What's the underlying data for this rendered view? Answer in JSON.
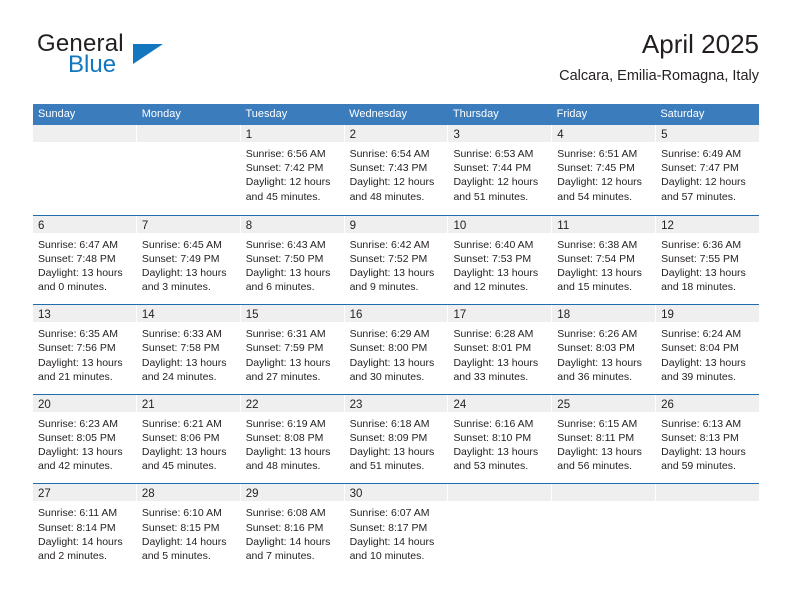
{
  "brand": {
    "name_top": "General",
    "name_bottom": "Blue"
  },
  "header": {
    "title": "April 2025",
    "subtitle": "Calcara, Emilia-Romagna, Italy"
  },
  "theme": {
    "header_blue": "#3b7cbd",
    "separator_blue": "#1f6cb0",
    "daynum_band": "#efefef",
    "brand_blue": "#1277bf",
    "text": "#231f20"
  },
  "labels": {
    "sunrise_prefix": "Sunrise:",
    "sunset_prefix": "Sunset:",
    "daylight_prefix": "Daylight:"
  },
  "weekdays": [
    "Sunday",
    "Monday",
    "Tuesday",
    "Wednesday",
    "Thursday",
    "Friday",
    "Saturday"
  ],
  "weeks": [
    [
      {
        "day": ""
      },
      {
        "day": ""
      },
      {
        "day": "1",
        "sunrise": "Sunrise: 6:56 AM",
        "sunset": "Sunset: 7:42 PM",
        "daylight_1": "Daylight: 12 hours",
        "daylight_2": "and 45 minutes."
      },
      {
        "day": "2",
        "sunrise": "Sunrise: 6:54 AM",
        "sunset": "Sunset: 7:43 PM",
        "daylight_1": "Daylight: 12 hours",
        "daylight_2": "and 48 minutes."
      },
      {
        "day": "3",
        "sunrise": "Sunrise: 6:53 AM",
        "sunset": "Sunset: 7:44 PM",
        "daylight_1": "Daylight: 12 hours",
        "daylight_2": "and 51 minutes."
      },
      {
        "day": "4",
        "sunrise": "Sunrise: 6:51 AM",
        "sunset": "Sunset: 7:45 PM",
        "daylight_1": "Daylight: 12 hours",
        "daylight_2": "and 54 minutes."
      },
      {
        "day": "5",
        "sunrise": "Sunrise: 6:49 AM",
        "sunset": "Sunset: 7:47 PM",
        "daylight_1": "Daylight: 12 hours",
        "daylight_2": "and 57 minutes."
      }
    ],
    [
      {
        "day": "6",
        "sunrise": "Sunrise: 6:47 AM",
        "sunset": "Sunset: 7:48 PM",
        "daylight_1": "Daylight: 13 hours",
        "daylight_2": "and 0 minutes."
      },
      {
        "day": "7",
        "sunrise": "Sunrise: 6:45 AM",
        "sunset": "Sunset: 7:49 PM",
        "daylight_1": "Daylight: 13 hours",
        "daylight_2": "and 3 minutes."
      },
      {
        "day": "8",
        "sunrise": "Sunrise: 6:43 AM",
        "sunset": "Sunset: 7:50 PM",
        "daylight_1": "Daylight: 13 hours",
        "daylight_2": "and 6 minutes."
      },
      {
        "day": "9",
        "sunrise": "Sunrise: 6:42 AM",
        "sunset": "Sunset: 7:52 PM",
        "daylight_1": "Daylight: 13 hours",
        "daylight_2": "and 9 minutes."
      },
      {
        "day": "10",
        "sunrise": "Sunrise: 6:40 AM",
        "sunset": "Sunset: 7:53 PM",
        "daylight_1": "Daylight: 13 hours",
        "daylight_2": "and 12 minutes."
      },
      {
        "day": "11",
        "sunrise": "Sunrise: 6:38 AM",
        "sunset": "Sunset: 7:54 PM",
        "daylight_1": "Daylight: 13 hours",
        "daylight_2": "and 15 minutes."
      },
      {
        "day": "12",
        "sunrise": "Sunrise: 6:36 AM",
        "sunset": "Sunset: 7:55 PM",
        "daylight_1": "Daylight: 13 hours",
        "daylight_2": "and 18 minutes."
      }
    ],
    [
      {
        "day": "13",
        "sunrise": "Sunrise: 6:35 AM",
        "sunset": "Sunset: 7:56 PM",
        "daylight_1": "Daylight: 13 hours",
        "daylight_2": "and 21 minutes."
      },
      {
        "day": "14",
        "sunrise": "Sunrise: 6:33 AM",
        "sunset": "Sunset: 7:58 PM",
        "daylight_1": "Daylight: 13 hours",
        "daylight_2": "and 24 minutes."
      },
      {
        "day": "15",
        "sunrise": "Sunrise: 6:31 AM",
        "sunset": "Sunset: 7:59 PM",
        "daylight_1": "Daylight: 13 hours",
        "daylight_2": "and 27 minutes."
      },
      {
        "day": "16",
        "sunrise": "Sunrise: 6:29 AM",
        "sunset": "Sunset: 8:00 PM",
        "daylight_1": "Daylight: 13 hours",
        "daylight_2": "and 30 minutes."
      },
      {
        "day": "17",
        "sunrise": "Sunrise: 6:28 AM",
        "sunset": "Sunset: 8:01 PM",
        "daylight_1": "Daylight: 13 hours",
        "daylight_2": "and 33 minutes."
      },
      {
        "day": "18",
        "sunrise": "Sunrise: 6:26 AM",
        "sunset": "Sunset: 8:03 PM",
        "daylight_1": "Daylight: 13 hours",
        "daylight_2": "and 36 minutes."
      },
      {
        "day": "19",
        "sunrise": "Sunrise: 6:24 AM",
        "sunset": "Sunset: 8:04 PM",
        "daylight_1": "Daylight: 13 hours",
        "daylight_2": "and 39 minutes."
      }
    ],
    [
      {
        "day": "20",
        "sunrise": "Sunrise: 6:23 AM",
        "sunset": "Sunset: 8:05 PM",
        "daylight_1": "Daylight: 13 hours",
        "daylight_2": "and 42 minutes."
      },
      {
        "day": "21",
        "sunrise": "Sunrise: 6:21 AM",
        "sunset": "Sunset: 8:06 PM",
        "daylight_1": "Daylight: 13 hours",
        "daylight_2": "and 45 minutes."
      },
      {
        "day": "22",
        "sunrise": "Sunrise: 6:19 AM",
        "sunset": "Sunset: 8:08 PM",
        "daylight_1": "Daylight: 13 hours",
        "daylight_2": "and 48 minutes."
      },
      {
        "day": "23",
        "sunrise": "Sunrise: 6:18 AM",
        "sunset": "Sunset: 8:09 PM",
        "daylight_1": "Daylight: 13 hours",
        "daylight_2": "and 51 minutes."
      },
      {
        "day": "24",
        "sunrise": "Sunrise: 6:16 AM",
        "sunset": "Sunset: 8:10 PM",
        "daylight_1": "Daylight: 13 hours",
        "daylight_2": "and 53 minutes."
      },
      {
        "day": "25",
        "sunrise": "Sunrise: 6:15 AM",
        "sunset": "Sunset: 8:11 PM",
        "daylight_1": "Daylight: 13 hours",
        "daylight_2": "and 56 minutes."
      },
      {
        "day": "26",
        "sunrise": "Sunrise: 6:13 AM",
        "sunset": "Sunset: 8:13 PM",
        "daylight_1": "Daylight: 13 hours",
        "daylight_2": "and 59 minutes."
      }
    ],
    [
      {
        "day": "27",
        "sunrise": "Sunrise: 6:11 AM",
        "sunset": "Sunset: 8:14 PM",
        "daylight_1": "Daylight: 14 hours",
        "daylight_2": "and 2 minutes."
      },
      {
        "day": "28",
        "sunrise": "Sunrise: 6:10 AM",
        "sunset": "Sunset: 8:15 PM",
        "daylight_1": "Daylight: 14 hours",
        "daylight_2": "and 5 minutes."
      },
      {
        "day": "29",
        "sunrise": "Sunrise: 6:08 AM",
        "sunset": "Sunset: 8:16 PM",
        "daylight_1": "Daylight: 14 hours",
        "daylight_2": "and 7 minutes."
      },
      {
        "day": "30",
        "sunrise": "Sunrise: 6:07 AM",
        "sunset": "Sunset: 8:17 PM",
        "daylight_1": "Daylight: 14 hours",
        "daylight_2": "and 10 minutes."
      },
      {
        "day": ""
      },
      {
        "day": ""
      },
      {
        "day": ""
      }
    ]
  ]
}
